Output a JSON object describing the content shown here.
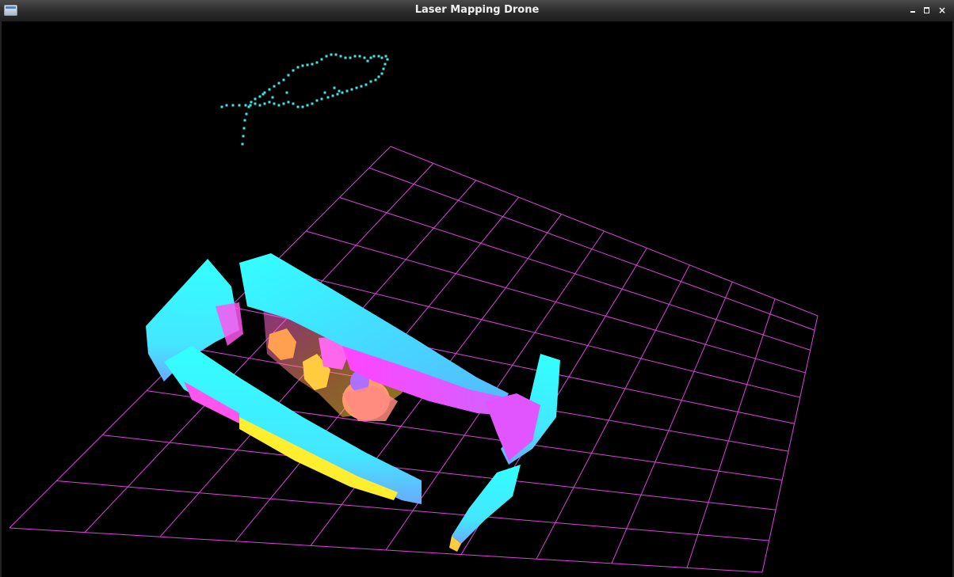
{
  "window": {
    "title": "Laser Mapping Drone",
    "close_glyph": "×",
    "app_icon": "window-app-icon"
  },
  "scene": {
    "background": "#000000",
    "grid_color": "#e040e0",
    "trajectory_color": "#38e8e8",
    "point_cloud_colors": [
      "#33ffff",
      "#ff44ff",
      "#ffa050",
      "#ffff33",
      "#66aaff"
    ]
  }
}
